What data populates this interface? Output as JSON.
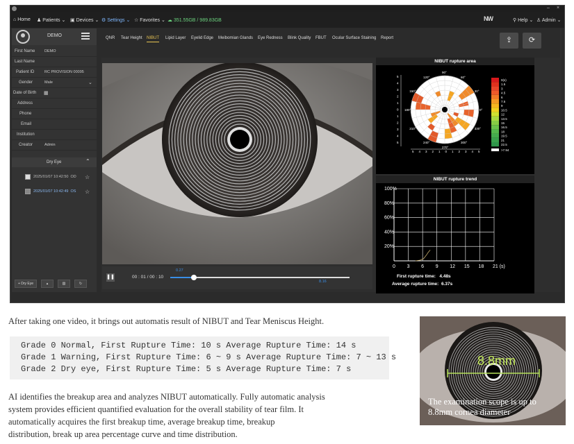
{
  "menubar": {
    "home": "Home",
    "patients": "Patients",
    "devices": "Devices",
    "settings": "Settings",
    "favorites": "Favorites",
    "storage": "351.55GB / 989.83GB",
    "brand": "NW",
    "help": "Help",
    "admin": "Admin"
  },
  "window": {
    "minimize": "–",
    "close": "×"
  },
  "profile": {
    "name": "DEMO"
  },
  "fields": [
    {
      "label": "First Name",
      "value": "DEMO"
    },
    {
      "label": "Last Name",
      "value": ""
    },
    {
      "label": "Patient ID",
      "value": "RC PROVISION 00095"
    },
    {
      "label": "Gender",
      "value": "Male"
    },
    {
      "label": "Date of Birth",
      "value": ""
    },
    {
      "label": "Address",
      "value": ""
    },
    {
      "label": "Phone",
      "value": ""
    },
    {
      "label": "Email",
      "value": ""
    },
    {
      "label": "Institution",
      "value": ""
    },
    {
      "label": "Creator",
      "value": "Admin"
    }
  ],
  "exam": {
    "group": "Dry Eye",
    "records": [
      {
        "date": "2025/01/07 10:42:50",
        "eye": "OD"
      },
      {
        "date": "2025/01/07 10:42:49",
        "eye": "OS"
      }
    ]
  },
  "sidebar_buttons": {
    "dry_eye": "+ Dry Eye"
  },
  "tabs": [
    "QNR",
    "Tear Height",
    "NIBUT",
    "Lipid Layer",
    "Eyelid Edge",
    "Meibomian Glands",
    "Eye Redness",
    "Blink Quality",
    "FBUT",
    "Ocular Surface Staining",
    "Report"
  ],
  "active_tab": "NIBUT",
  "player": {
    "time": "00 : 01 / 00 : 10",
    "marker_top": "0.27",
    "marker_bottom": "8.16",
    "progress": 0.13
  },
  "area_panel": {
    "title": "NIBUT rupture area",
    "scale": [
      "0(s)",
      "1.5",
      "3",
      "4.5",
      "6",
      "7.5",
      "9",
      "10.5",
      "12",
      "13.5",
      "15",
      "16.5",
      "18",
      "19.5",
      "21",
      "22.5"
    ],
    "scale_max": ">7.94",
    "angle_labels": [
      "90°",
      "120°",
      "150°",
      "180°",
      "210°",
      "240°",
      "270°",
      "300°",
      "330°",
      "0°",
      "30°",
      "60°"
    ],
    "axis_ticks": [
      "5",
      "4",
      "3",
      "2",
      "1",
      "0",
      "1",
      "2",
      "3",
      "4",
      "5"
    ]
  },
  "trend_panel": {
    "title": "NIBUT rupture trend",
    "first_label": "First rupture time:",
    "first_value": "4.48s",
    "avg_label": "Average rupture time:",
    "avg_value": "6.37s"
  },
  "chart_data": {
    "type": "line",
    "title": "NIBUT rupture trend",
    "x_ticks": [
      "0",
      "3",
      "6",
      "9",
      "12",
      "15",
      "18",
      "21 (s)"
    ],
    "y_ticks": [
      "20%",
      "40%",
      "60%",
      "80%",
      "100%"
    ],
    "xlim": [
      0,
      21
    ],
    "ylim": [
      0,
      100
    ],
    "series": [
      {
        "x": [
          4.48,
          5.5,
          6.2,
          6.8,
          7.2,
          7.6
        ],
        "y": [
          0,
          1,
          3,
          8,
          12,
          15
        ]
      }
    ]
  },
  "text": {
    "line1": "After taking one video, it brings out automatis result of NIBUT and Tear Meniscus Height.",
    "grades": [
      "Grade 0 Normal, First Rupture Time: 10 s Average Rupture Time: 14 s",
      "Grade 1 Warning, First Rupture Time: 6 ~ 9 s Average Rupture Time: 7 ~ 13 s",
      "Grade 2 Dry eye, First Rupture Time: 5 s Average Rupture Time: 7 s"
    ],
    "para": [
      "AI identifies the breakup area and analyzes NIBUT automatically. Fully automatic analysis",
      "system provides efficient quantified evaluation for the overall stability of tear film. It",
      "automatically acquires the first breakup time, average breakup time, breakup",
      "distribution, break up area percentage curve and time distribution."
    ],
    "photo_measure": "8.8mm",
    "photo_caption": [
      "The examination scope is up to",
      "8.8mm cornea diameter"
    ]
  }
}
